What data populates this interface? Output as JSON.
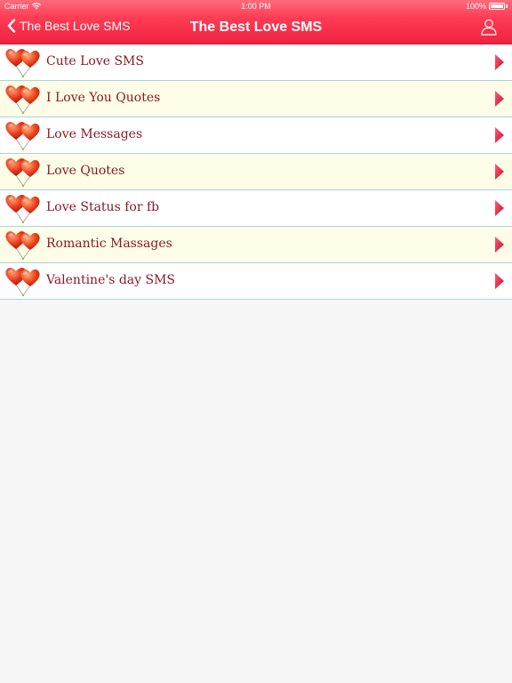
{
  "status_bar": {
    "carrier": "Carrier",
    "time": "1:00 PM",
    "battery": "100%"
  },
  "nav": {
    "back_label": "The Best Love SMS",
    "title": "The Best Love SMS"
  },
  "colors": {
    "header": "#ff3c55",
    "item_text": "#8a1a25",
    "arrow": "#e8213c",
    "row_alt": "#fdfde8",
    "divider": "#a9d3df"
  },
  "items": [
    {
      "label": "Cute Love SMS",
      "icon": "hearts-balloon-icon"
    },
    {
      "label": "I Love You Quotes",
      "icon": "hearts-balloon-icon"
    },
    {
      "label": "Love Messages",
      "icon": "hearts-balloon-icon"
    },
    {
      "label": "Love Quotes",
      "icon": "hearts-balloon-icon"
    },
    {
      "label": "Love Status for fb",
      "icon": "hearts-balloon-icon"
    },
    {
      "label": "Romantic Massages",
      "icon": "hearts-balloon-icon"
    },
    {
      "label": "Valentine's day SMS",
      "icon": "hearts-balloon-icon"
    }
  ]
}
